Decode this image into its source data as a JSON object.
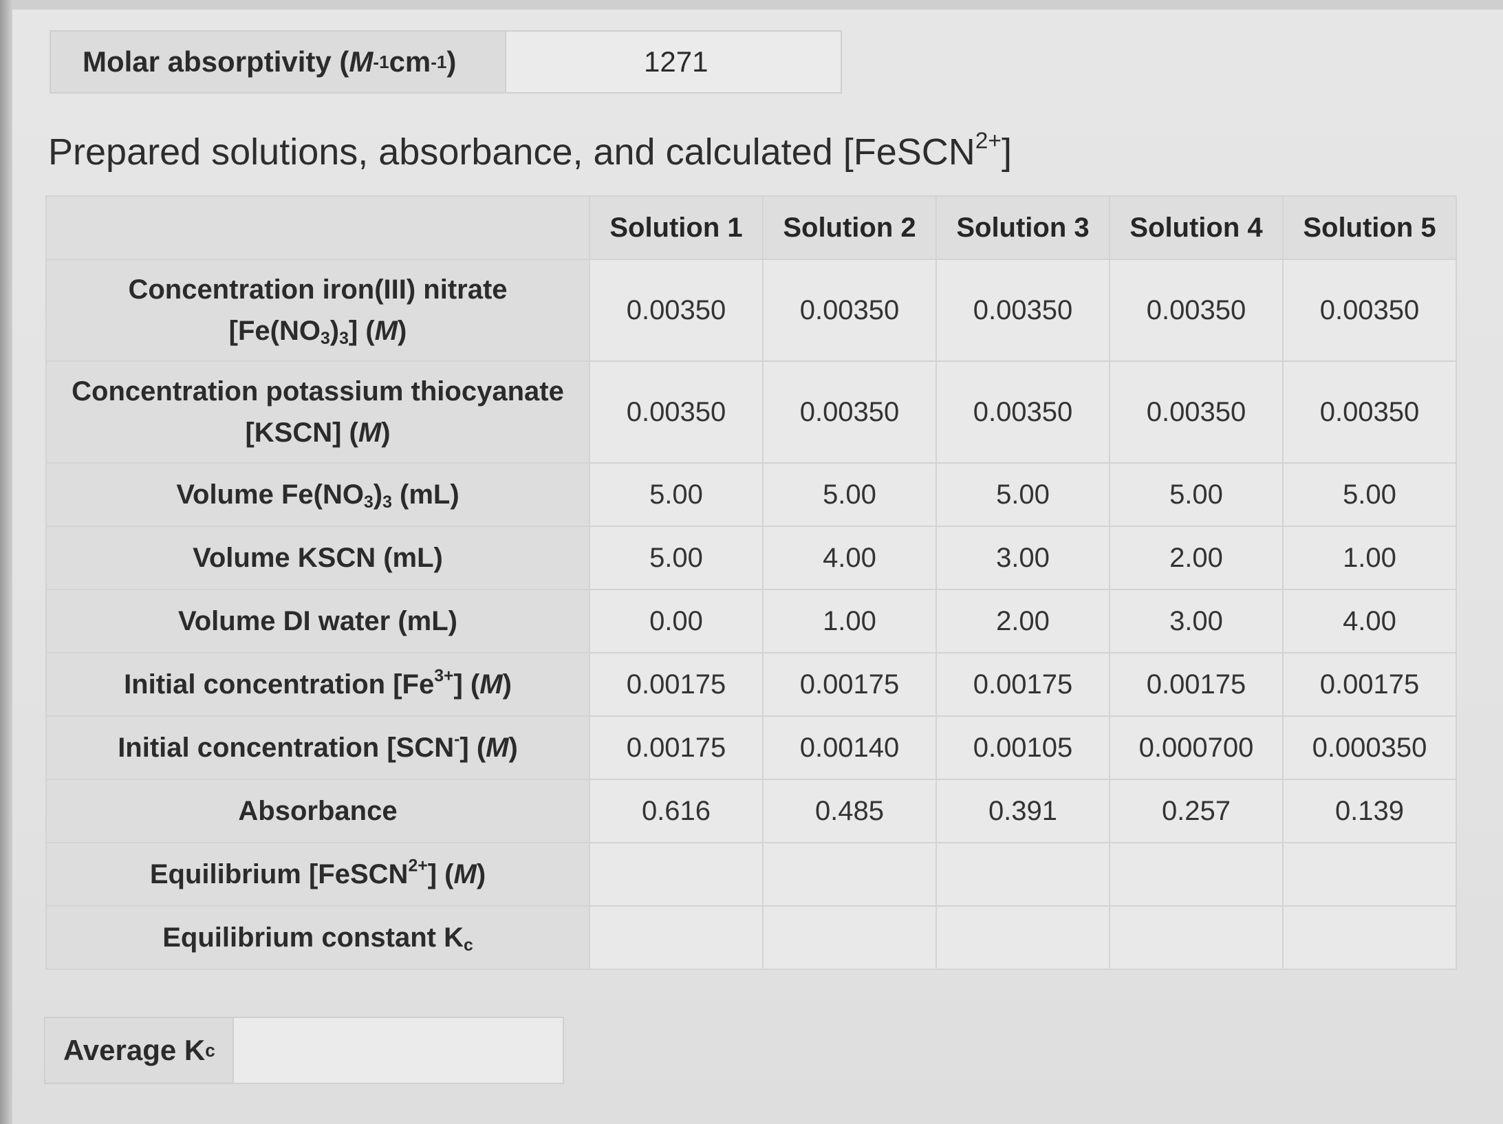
{
  "molar_absorptivity": {
    "label": "Molar absorptivity (",
    "unit_M": "M",
    "unit_exp1": "-1",
    "unit_cm": "cm",
    "unit_exp2": "-1",
    "label_close": ")",
    "value": "1271"
  },
  "section_title": {
    "text": "Prepared solutions, absorbance, and calculated [FeSCN",
    "sup": "2+",
    "close": "]"
  },
  "table": {
    "columns": [
      "Solution 1",
      "Solution 2",
      "Solution 3",
      "Solution 4",
      "Solution 5"
    ],
    "rows": [
      {
        "label_line1": "Concentration iron(III) nitrate",
        "label_line2_a": "[Fe(NO",
        "label_line2_sub1": "3",
        "label_line2_b": ")",
        "label_line2_sub2": "3",
        "label_line2_c": "] (",
        "label_line2_M": "M",
        "label_line2_d": ")",
        "values": [
          "0.00350",
          "0.00350",
          "0.00350",
          "0.00350",
          "0.00350"
        ]
      },
      {
        "label_line1": "Concentration potassium thiocyanate",
        "label_line2_a": "[KSCN] (",
        "label_line2_M": "M",
        "label_line2_d": ")",
        "values": [
          "0.00350",
          "0.00350",
          "0.00350",
          "0.00350",
          "0.00350"
        ]
      },
      {
        "label_a": "Volume Fe(NO",
        "label_sub1": "3",
        "label_b": ")",
        "label_sub2": "3",
        "label_c": " (mL)",
        "values": [
          "5.00",
          "5.00",
          "5.00",
          "5.00",
          "5.00"
        ]
      },
      {
        "label": "Volume KSCN (mL)",
        "values": [
          "5.00",
          "4.00",
          "3.00",
          "2.00",
          "1.00"
        ]
      },
      {
        "label": "Volume DI water (mL)",
        "values": [
          "0.00",
          "1.00",
          "2.00",
          "3.00",
          "4.00"
        ]
      },
      {
        "label_a": "Initial concentration [Fe",
        "label_sup": "3+",
        "label_b": "] (",
        "label_M": "M",
        "label_c": ")",
        "values": [
          "0.00175",
          "0.00175",
          "0.00175",
          "0.00175",
          "0.00175"
        ]
      },
      {
        "label_a": "Initial concentration [SCN",
        "label_sup": "-",
        "label_b": "] (",
        "label_M": "M",
        "label_c": ")",
        "values": [
          "0.00175",
          "0.00140",
          "0.00105",
          "0.000700",
          "0.000350"
        ]
      },
      {
        "label": "Absorbance",
        "values": [
          "0.616",
          "0.485",
          "0.391",
          "0.257",
          "0.139"
        ]
      },
      {
        "label_a": "Equilibrium [FeSCN",
        "label_sup": "2+",
        "label_b": "] (",
        "label_M": "M",
        "label_c": ")",
        "values": [
          "",
          "",
          "",
          "",
          ""
        ]
      },
      {
        "label_a": "Equilibrium constant K",
        "label_sub": "c",
        "values": [
          "",
          "",
          "",
          "",
          ""
        ]
      }
    ]
  },
  "average_kc": {
    "label_a": "Average K",
    "label_sub": "c",
    "value": ""
  }
}
